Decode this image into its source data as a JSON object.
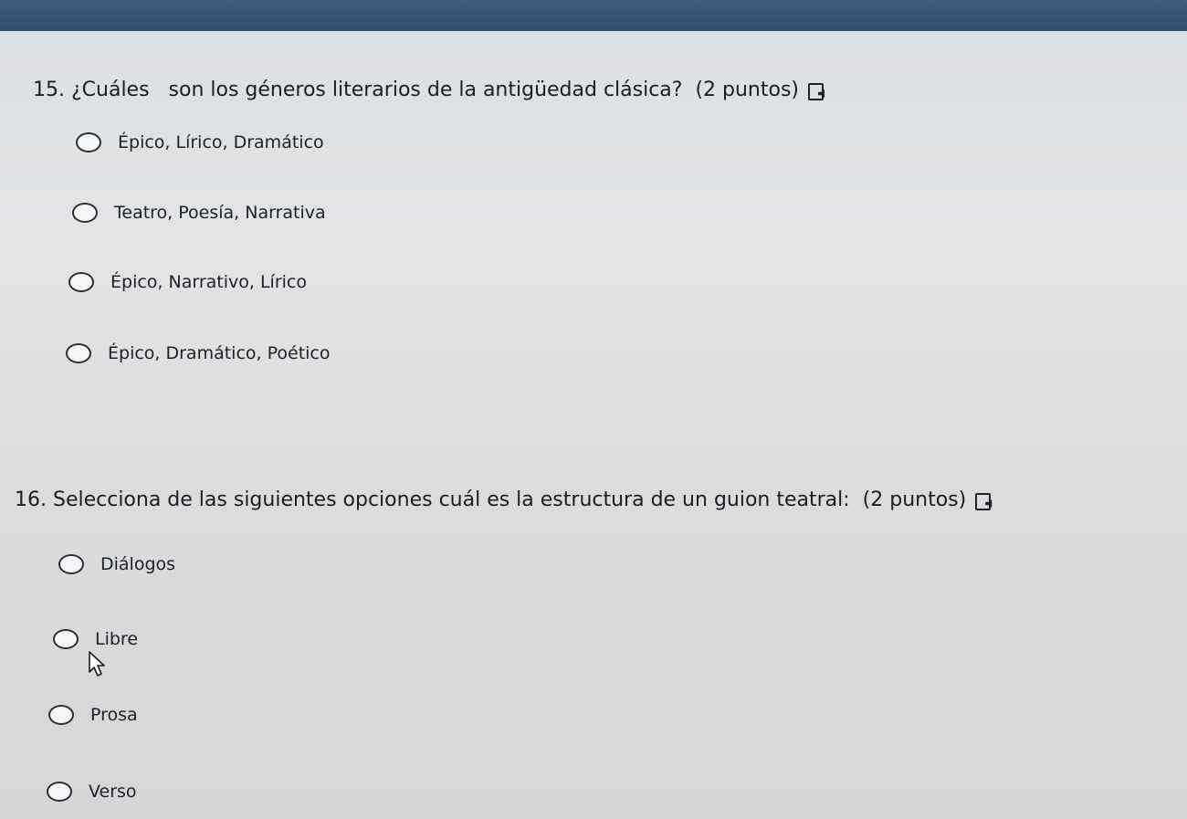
{
  "questions": [
    {
      "title": "15. ¿Cuáles   son los géneros literarios de la antigüedad clásica?  (2 puntos)",
      "reader_icon": "immersive-reader-icon",
      "options": [
        {
          "label": "Épico, Lírico, Dramático",
          "selected": false
        },
        {
          "label": "Teatro, Poesía, Narrativa",
          "selected": false
        },
        {
          "label": "Épico, Narrativo, Lírico",
          "selected": false
        },
        {
          "label": "Épico, Dramático, Poético",
          "selected": false
        }
      ]
    },
    {
      "title": "16. Selecciona de las siguientes opciones cuál es la estructura de un guion teatral:  (2 puntos)",
      "reader_icon": "immersive-reader-icon",
      "options": [
        {
          "label": "Diálogos",
          "selected": false
        },
        {
          "label": "Libre",
          "selected": false
        },
        {
          "label": "Prosa",
          "selected": false
        },
        {
          "label": "Verso",
          "selected": false
        }
      ]
    }
  ],
  "colors": {
    "top_bar": "#2f4e6d",
    "background": "#dcdfe2",
    "text": "#1d1f22"
  },
  "cursor_icon": "mouse-pointer-icon"
}
